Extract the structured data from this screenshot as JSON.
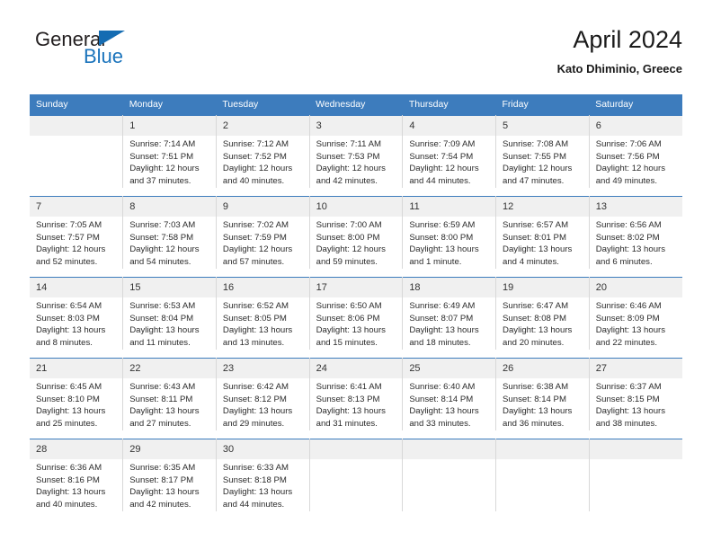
{
  "brand": {
    "name_line1": "General",
    "name_line2": "Blue",
    "triangle_color": "#156cb2",
    "blue_color": "#1b74bc"
  },
  "header": {
    "title": "April 2024",
    "subtitle": "Kato Dhiminio, Greece"
  },
  "theme": {
    "header_band": "#3d7cbd",
    "date_band": "#f0f0f0",
    "text": "#2b2b2b"
  },
  "weekdays": [
    "Sunday",
    "Monday",
    "Tuesday",
    "Wednesday",
    "Thursday",
    "Friday",
    "Saturday"
  ],
  "weeks": [
    [
      {
        "date": "",
        "blank": true,
        "sunrise": "",
        "sunset": "",
        "daylight1": "",
        "daylight2": ""
      },
      {
        "date": "1",
        "sunrise": "Sunrise: 7:14 AM",
        "sunset": "Sunset: 7:51 PM",
        "daylight1": "Daylight: 12 hours",
        "daylight2": "and 37 minutes."
      },
      {
        "date": "2",
        "sunrise": "Sunrise: 7:12 AM",
        "sunset": "Sunset: 7:52 PM",
        "daylight1": "Daylight: 12 hours",
        "daylight2": "and 40 minutes."
      },
      {
        "date": "3",
        "sunrise": "Sunrise: 7:11 AM",
        "sunset": "Sunset: 7:53 PM",
        "daylight1": "Daylight: 12 hours",
        "daylight2": "and 42 minutes."
      },
      {
        "date": "4",
        "sunrise": "Sunrise: 7:09 AM",
        "sunset": "Sunset: 7:54 PM",
        "daylight1": "Daylight: 12 hours",
        "daylight2": "and 44 minutes."
      },
      {
        "date": "5",
        "sunrise": "Sunrise: 7:08 AM",
        "sunset": "Sunset: 7:55 PM",
        "daylight1": "Daylight: 12 hours",
        "daylight2": "and 47 minutes."
      },
      {
        "date": "6",
        "sunrise": "Sunrise: 7:06 AM",
        "sunset": "Sunset: 7:56 PM",
        "daylight1": "Daylight: 12 hours",
        "daylight2": "and 49 minutes."
      }
    ],
    [
      {
        "date": "7",
        "sunrise": "Sunrise: 7:05 AM",
        "sunset": "Sunset: 7:57 PM",
        "daylight1": "Daylight: 12 hours",
        "daylight2": "and 52 minutes."
      },
      {
        "date": "8",
        "sunrise": "Sunrise: 7:03 AM",
        "sunset": "Sunset: 7:58 PM",
        "daylight1": "Daylight: 12 hours",
        "daylight2": "and 54 minutes."
      },
      {
        "date": "9",
        "sunrise": "Sunrise: 7:02 AM",
        "sunset": "Sunset: 7:59 PM",
        "daylight1": "Daylight: 12 hours",
        "daylight2": "and 57 minutes."
      },
      {
        "date": "10",
        "sunrise": "Sunrise: 7:00 AM",
        "sunset": "Sunset: 8:00 PM",
        "daylight1": "Daylight: 12 hours",
        "daylight2": "and 59 minutes."
      },
      {
        "date": "11",
        "sunrise": "Sunrise: 6:59 AM",
        "sunset": "Sunset: 8:00 PM",
        "daylight1": "Daylight: 13 hours",
        "daylight2": "and 1 minute."
      },
      {
        "date": "12",
        "sunrise": "Sunrise: 6:57 AM",
        "sunset": "Sunset: 8:01 PM",
        "daylight1": "Daylight: 13 hours",
        "daylight2": "and 4 minutes."
      },
      {
        "date": "13",
        "sunrise": "Sunrise: 6:56 AM",
        "sunset": "Sunset: 8:02 PM",
        "daylight1": "Daylight: 13 hours",
        "daylight2": "and 6 minutes."
      }
    ],
    [
      {
        "date": "14",
        "sunrise": "Sunrise: 6:54 AM",
        "sunset": "Sunset: 8:03 PM",
        "daylight1": "Daylight: 13 hours",
        "daylight2": "and 8 minutes."
      },
      {
        "date": "15",
        "sunrise": "Sunrise: 6:53 AM",
        "sunset": "Sunset: 8:04 PM",
        "daylight1": "Daylight: 13 hours",
        "daylight2": "and 11 minutes."
      },
      {
        "date": "16",
        "sunrise": "Sunrise: 6:52 AM",
        "sunset": "Sunset: 8:05 PM",
        "daylight1": "Daylight: 13 hours",
        "daylight2": "and 13 minutes."
      },
      {
        "date": "17",
        "sunrise": "Sunrise: 6:50 AM",
        "sunset": "Sunset: 8:06 PM",
        "daylight1": "Daylight: 13 hours",
        "daylight2": "and 15 minutes."
      },
      {
        "date": "18",
        "sunrise": "Sunrise: 6:49 AM",
        "sunset": "Sunset: 8:07 PM",
        "daylight1": "Daylight: 13 hours",
        "daylight2": "and 18 minutes."
      },
      {
        "date": "19",
        "sunrise": "Sunrise: 6:47 AM",
        "sunset": "Sunset: 8:08 PM",
        "daylight1": "Daylight: 13 hours",
        "daylight2": "and 20 minutes."
      },
      {
        "date": "20",
        "sunrise": "Sunrise: 6:46 AM",
        "sunset": "Sunset: 8:09 PM",
        "daylight1": "Daylight: 13 hours",
        "daylight2": "and 22 minutes."
      }
    ],
    [
      {
        "date": "21",
        "sunrise": "Sunrise: 6:45 AM",
        "sunset": "Sunset: 8:10 PM",
        "daylight1": "Daylight: 13 hours",
        "daylight2": "and 25 minutes."
      },
      {
        "date": "22",
        "sunrise": "Sunrise: 6:43 AM",
        "sunset": "Sunset: 8:11 PM",
        "daylight1": "Daylight: 13 hours",
        "daylight2": "and 27 minutes."
      },
      {
        "date": "23",
        "sunrise": "Sunrise: 6:42 AM",
        "sunset": "Sunset: 8:12 PM",
        "daylight1": "Daylight: 13 hours",
        "daylight2": "and 29 minutes."
      },
      {
        "date": "24",
        "sunrise": "Sunrise: 6:41 AM",
        "sunset": "Sunset: 8:13 PM",
        "daylight1": "Daylight: 13 hours",
        "daylight2": "and 31 minutes."
      },
      {
        "date": "25",
        "sunrise": "Sunrise: 6:40 AM",
        "sunset": "Sunset: 8:14 PM",
        "daylight1": "Daylight: 13 hours",
        "daylight2": "and 33 minutes."
      },
      {
        "date": "26",
        "sunrise": "Sunrise: 6:38 AM",
        "sunset": "Sunset: 8:14 PM",
        "daylight1": "Daylight: 13 hours",
        "daylight2": "and 36 minutes."
      },
      {
        "date": "27",
        "sunrise": "Sunrise: 6:37 AM",
        "sunset": "Sunset: 8:15 PM",
        "daylight1": "Daylight: 13 hours",
        "daylight2": "and 38 minutes."
      }
    ],
    [
      {
        "date": "28",
        "sunrise": "Sunrise: 6:36 AM",
        "sunset": "Sunset: 8:16 PM",
        "daylight1": "Daylight: 13 hours",
        "daylight2": "and 40 minutes."
      },
      {
        "date": "29",
        "sunrise": "Sunrise: 6:35 AM",
        "sunset": "Sunset: 8:17 PM",
        "daylight1": "Daylight: 13 hours",
        "daylight2": "and 42 minutes."
      },
      {
        "date": "30",
        "sunrise": "Sunrise: 6:33 AM",
        "sunset": "Sunset: 8:18 PM",
        "daylight1": "Daylight: 13 hours",
        "daylight2": "and 44 minutes."
      },
      {
        "date": "",
        "blank": true,
        "sunrise": "",
        "sunset": "",
        "daylight1": "",
        "daylight2": ""
      },
      {
        "date": "",
        "blank": true,
        "sunrise": "",
        "sunset": "",
        "daylight1": "",
        "daylight2": ""
      },
      {
        "date": "",
        "blank": true,
        "sunrise": "",
        "sunset": "",
        "daylight1": "",
        "daylight2": ""
      },
      {
        "date": "",
        "blank": true,
        "sunrise": "",
        "sunset": "",
        "daylight1": "",
        "daylight2": ""
      }
    ]
  ]
}
